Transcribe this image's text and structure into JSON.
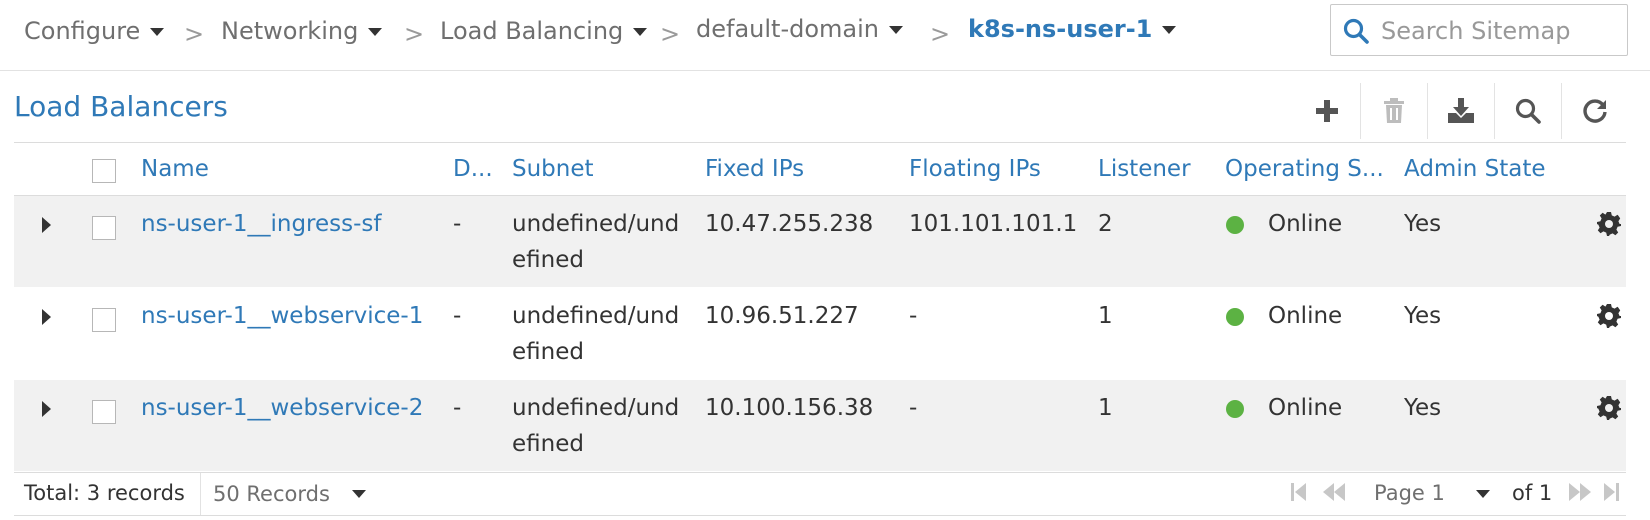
{
  "breadcrumb": {
    "items": [
      {
        "label": "Configure"
      },
      {
        "label": "Networking"
      },
      {
        "label": "Load Balancing"
      },
      {
        "label": "default-domain"
      },
      {
        "label": "k8s-ns-user-1"
      }
    ],
    "separator": ">"
  },
  "search": {
    "placeholder": "Search Sitemap",
    "value": ""
  },
  "page": {
    "title": "Load Balancers"
  },
  "toolbar": {
    "icons": [
      "plus-icon",
      "trash-icon",
      "download-icon",
      "search-icon",
      "refresh-icon"
    ]
  },
  "table": {
    "headers": {
      "name": "Name",
      "d": "D...",
      "subnet": "Subnet",
      "fixed_ips": "Fixed IPs",
      "floating_ips": "Floating IPs",
      "listener": "Listener",
      "operating_status": "Operating S...",
      "admin_state": "Admin State"
    },
    "rows": [
      {
        "name": "ns-user-1__ingress-sf",
        "d": "-",
        "subnet": "undefined/undefined",
        "fixed_ips": "10.47.255.238",
        "floating_ips": "101.101.101.1",
        "listener": "2",
        "status": "Online",
        "admin": "Yes"
      },
      {
        "name": "ns-user-1__webservice-1",
        "d": "-",
        "subnet": "undefined/undefined",
        "fixed_ips": "10.96.51.227",
        "floating_ips": "-",
        "listener": "1",
        "status": "Online",
        "admin": "Yes"
      },
      {
        "name": "ns-user-1__webservice-2",
        "d": "-",
        "subnet": "undefined/undefined",
        "fixed_ips": "10.100.156.38",
        "floating_ips": "-",
        "listener": "1",
        "status": "Online",
        "admin": "Yes"
      }
    ],
    "status_color": "#5cb243"
  },
  "footer": {
    "total": "Total: 3 records",
    "page_size": "50 Records",
    "page_label": "Page 1",
    "of_label": "of 1"
  },
  "colors": {
    "accent": "#2f79b7",
    "online": "#5cb243"
  }
}
